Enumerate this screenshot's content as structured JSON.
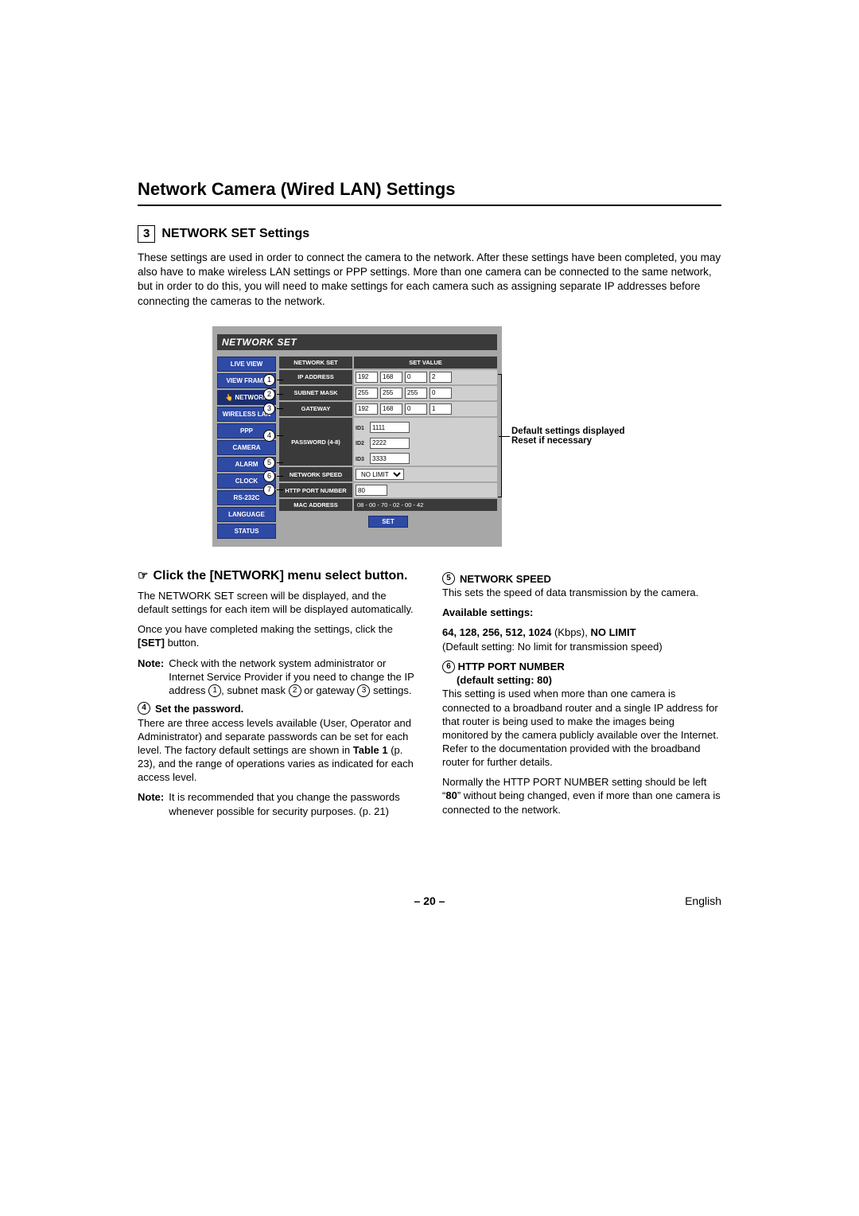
{
  "page_title": "Network Camera (Wired LAN) Settings",
  "section": {
    "number": "3",
    "title": "NETWORK SET Settings"
  },
  "intro": "These settings are used in order to connect the camera to the network. After these settings have been completed, you may also have to make wireless LAN settings or PPP settings. More than one camera can be connected to the same network, but in order to do this, you will need to make settings for each camera such as assigning separate IP addresses before connecting the cameras to the network.",
  "ui": {
    "window_title": "NETWORK SET",
    "menu": [
      "LIVE VIEW",
      "VIEW FRAME",
      "NETWORK",
      "WIRELESS LAN",
      "PPP",
      "CAMERA",
      "ALARM",
      "CLOCK",
      "RS-232C",
      "LANGUAGE",
      "STATUS"
    ],
    "active_menu_index": 2,
    "header_left": "NETWORK SET",
    "header_right": "SET VALUE",
    "rows": {
      "ip": {
        "label": "IP ADDRESS",
        "v": [
          "192",
          "168",
          "0",
          "2"
        ]
      },
      "mask": {
        "label": "SUBNET MASK",
        "v": [
          "255",
          "255",
          "255",
          "0"
        ]
      },
      "gateway": {
        "label": "GATEWAY",
        "v": [
          "192",
          "168",
          "0",
          "1"
        ]
      },
      "password": {
        "label": "PASSWORD (4-8)",
        "ids": [
          "ID1",
          "ID2",
          "ID3"
        ],
        "v": [
          "1111",
          "2222",
          "3333"
        ]
      },
      "speed": {
        "label": "NETWORK SPEED",
        "value": "NO LIMIT"
      },
      "port": {
        "label": "HTTP PORT NUMBER",
        "value": "80"
      },
      "mac": {
        "label": "MAC ADDRESS",
        "value": "08 - 00 - 70 - 02 - 00 - 42"
      }
    },
    "set_button": "SET",
    "callouts": [
      "1",
      "2",
      "3",
      "4",
      "5",
      "6",
      "7"
    ],
    "right_note_line1": "Default settings displayed",
    "right_note_line2": "Reset if necessary"
  },
  "left_col": {
    "hand_heading": "Click the [NETWORK] menu select button.",
    "p1": "The NETWORK SET screen will be displayed, and the default settings for each item will be displayed automatically.",
    "p2_a": "Once you have completed making the settings, click the ",
    "p2_bold": "[SET]",
    "p2_b": " button.",
    "note1_label": "Note:",
    "note1_body_a": "Check with the network system administrator or Internet Service Provider if you need to change the IP address ",
    "note1_body_b": ", subnet mask ",
    "note1_body_c": " or gateway ",
    "note1_body_d": " settings.",
    "sub4_num": "4",
    "sub4_title": "Set the password.",
    "p3_a": "There are three access levels available (User, Operator and Administrator) and separate passwords can be set for each level. The factory default settings are shown in ",
    "p3_bold": "Table 1",
    "p3_b": " (p. 23), and the range of operations varies as indicated for each access level.",
    "note2_label": "Note:",
    "note2_body": "It is recommended that you change the passwords whenever possible for security purposes. (p. 21)"
  },
  "right_col": {
    "sub5_num": "5",
    "sub5_title": "NETWORK SPEED",
    "p5": "This sets the speed of data transmission by the camera.",
    "avail_label": "Available settings:",
    "avail_values_bold": "64, 128, 256, 512, 1024",
    "avail_values_tail": " (Kbps), ",
    "avail_nolimit": "NO LIMIT",
    "avail_default": "(Default setting: No limit for transmission speed)",
    "sub6_num": "6",
    "sub6_title": "HTTP PORT NUMBER",
    "sub6_sub": "default setting: 80)",
    "p6a": "This setting is used when more than one camera is connected to a broadband router and a single IP address for that router is being used to make the images being monitored by the camera publicly available over the Internet. Refer to the documentation provided with the broadband router for further details.",
    "p6b_a": "Normally the HTTP PORT NUMBER setting should be left “",
    "p6b_bold": "80",
    "p6b_b": "” without being changed, even if more than one camera is connected to the network."
  },
  "footer": {
    "page": "– 20 –",
    "lang": "English"
  }
}
